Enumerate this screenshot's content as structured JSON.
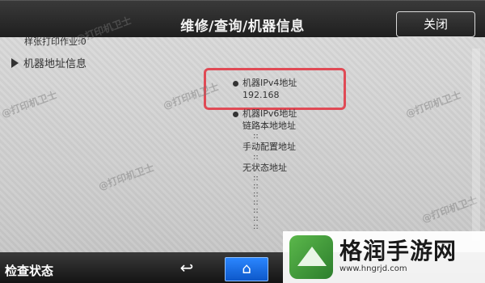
{
  "header": {
    "title": "维修/查询/机器信息",
    "close_label": "关闭"
  },
  "content": {
    "partial_line": "样张打印作业:0",
    "section_label": "机器地址信息",
    "items": {
      "ipv4_label": "机器IPv4地址",
      "ipv4_value": "192.168",
      "ipv6_label": "机器IPv6地址",
      "link_local_label": "链路本地地址",
      "manual_label": "手动配置地址",
      "stateless_label": "无状态地址",
      "sep": "::"
    }
  },
  "footer": {
    "status_label": "检查状态",
    "back_icon": "↩",
    "home_icon": "⌂"
  },
  "watermark": {
    "text": "@打印机卫士"
  },
  "brand": {
    "name": "格润手游网",
    "url": "www.hngrjd.com"
  },
  "colors": {
    "highlight": "#e04a55",
    "home_button": "#1a6ee6"
  },
  "icons": {
    "section_expander": "triangle-right-icon",
    "back": "back-arrow-icon",
    "home": "home-icon",
    "bullet": "bullet-icon",
    "logo": "brand-logo-icon"
  }
}
